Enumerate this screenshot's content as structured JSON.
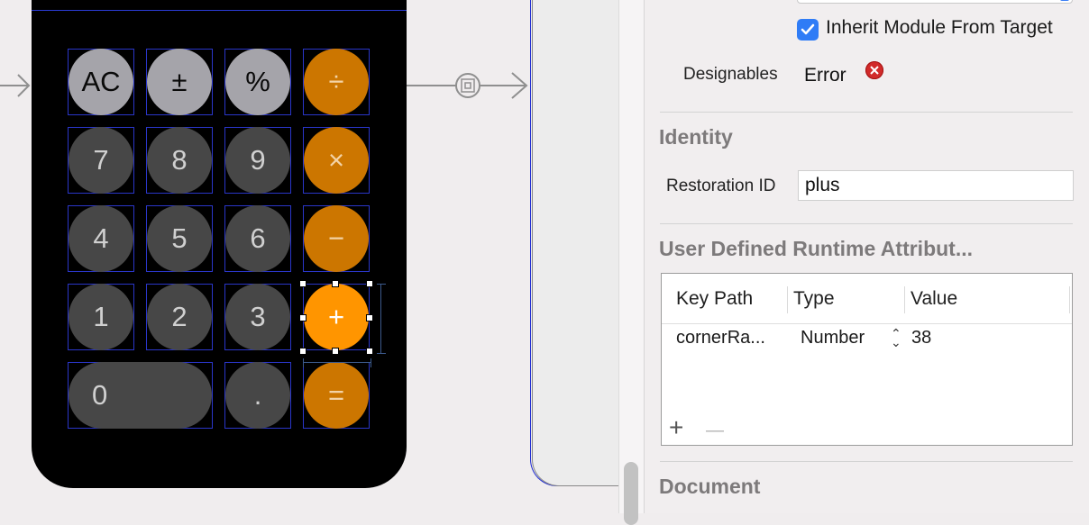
{
  "calculator": {
    "rows": [
      [
        {
          "label": "AC",
          "style": "light"
        },
        {
          "label": "±",
          "style": "light"
        },
        {
          "label": "%",
          "style": "light"
        },
        {
          "label": "÷",
          "style": "orange"
        }
      ],
      [
        {
          "label": "7",
          "style": "dark"
        },
        {
          "label": "8",
          "style": "dark"
        },
        {
          "label": "9",
          "style": "dark"
        },
        {
          "label": "×",
          "style": "orange"
        }
      ],
      [
        {
          "label": "4",
          "style": "dark"
        },
        {
          "label": "5",
          "style": "dark"
        },
        {
          "label": "6",
          "style": "dark"
        },
        {
          "label": "−",
          "style": "orange"
        }
      ],
      [
        {
          "label": "1",
          "style": "dark"
        },
        {
          "label": "2",
          "style": "dark"
        },
        {
          "label": "3",
          "style": "dark"
        },
        {
          "label": "+",
          "style": "orange-sel"
        }
      ],
      [
        {
          "label": "0",
          "style": "dark"
        },
        {
          "label": ".",
          "style": "dark"
        },
        {
          "label": "=",
          "style": "orange"
        }
      ]
    ]
  },
  "inspector": {
    "inherit_module_label": "Inherit Module From Target",
    "inherit_module_checked": true,
    "designables_label": "Designables",
    "designables_value": "Error",
    "identity_title": "Identity",
    "restoration_id_label": "Restoration ID",
    "restoration_id_value": "plus",
    "runtime_attrs_title": "User Defined Runtime Attribut...",
    "table": {
      "headers": [
        "Key Path",
        "Type",
        "Value"
      ],
      "rows": [
        {
          "key_path": "cornerRa...",
          "type": "Number",
          "value": "38"
        }
      ]
    },
    "add_symbol": "+",
    "remove_symbol": "—",
    "document_title": "Document"
  },
  "colors": {
    "accent": "#2f7cf6",
    "orange": "#ff9500",
    "error": "#d12a2a"
  }
}
